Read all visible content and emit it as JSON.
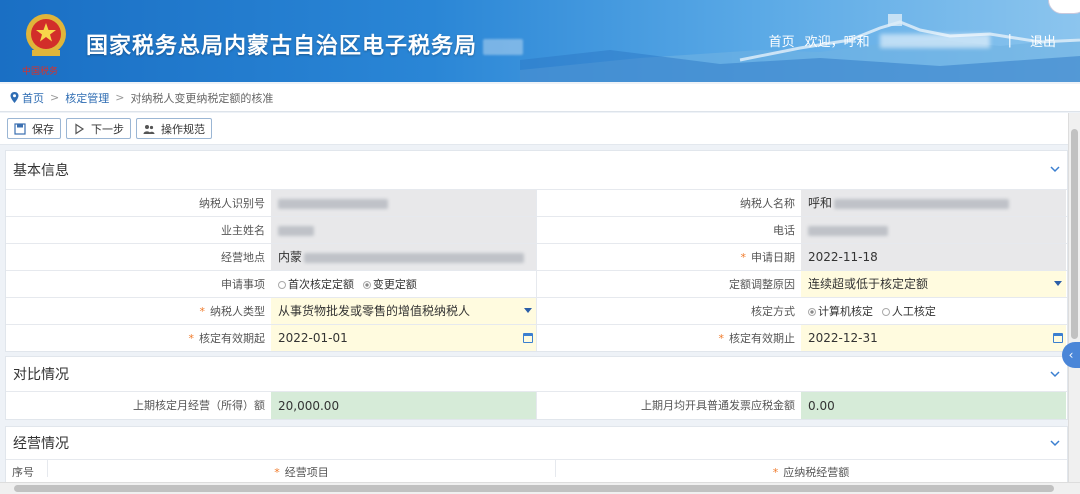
{
  "header": {
    "brand_sign": "中国税务",
    "site_title": "国家税务总局内蒙古自治区电子税务局",
    "nav_home": "首页",
    "nav_welcome": "欢迎，呼和",
    "nav_sep": "|",
    "nav_logout": "退出"
  },
  "breadcrumb": {
    "home": "首页",
    "level1": "核定管理",
    "current": "对纳税人变更纳税定额的核准"
  },
  "toolbar": {
    "save": "保存",
    "next": "下一步",
    "guide": "操作规范"
  },
  "basic": {
    "title": "基本信息",
    "taxpayer_id_label": "纳税人识别号",
    "taxpayer_name_label": "纳税人名称",
    "taxpayer_name_value": "呼和",
    "owner_label": "业主姓名",
    "phone_label": "电话",
    "address_label": "经营地点",
    "address_value": "内蒙",
    "apply_date_label": "申请日期",
    "apply_date_value": "2022-11-18",
    "apply_item_label": "申请事项",
    "apply_item_opt1": "首次核定定额",
    "apply_item_opt2": "变更定额",
    "adjust_reason_label": "定额调整原因",
    "adjust_reason_value": "连续超或低于核定定额",
    "taxpayer_type_label": "纳税人类型",
    "taxpayer_type_value": "从事货物批发或零售的增值税纳税人",
    "method_label": "核定方式",
    "method_opt1": "计算机核定",
    "method_opt2": "人工核定",
    "start_label": "核定有效期起",
    "start_value": "2022-01-01",
    "end_label": "核定有效期止",
    "end_value": "2022-12-31"
  },
  "compare": {
    "title": "对比情况",
    "prev_label": "上期核定月经营（所得）额",
    "prev_value": "20,000.00",
    "invoice_label": "上期月均开具普通发票应税金额",
    "invoice_value": "0.00"
  },
  "operation": {
    "title": "经营情况",
    "col_seq": "序号",
    "col_item": "经营项目",
    "col_amount": "应纳税经营额"
  },
  "colors": {
    "header_blue": "#1a6fc4",
    "link_blue": "#2f6db3",
    "required": "#f07a2a",
    "input_yellow": "#fffbdf",
    "readonly_gray": "#e8e8ea",
    "compare_green": "#d6ebd8"
  }
}
